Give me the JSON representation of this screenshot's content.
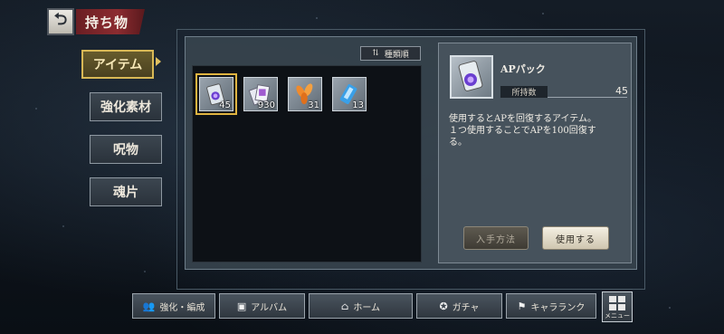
{
  "header": {
    "title": "持ち物"
  },
  "sidebar": {
    "items": [
      {
        "label": "アイテム",
        "active": true
      },
      {
        "label": "強化素材",
        "active": false
      },
      {
        "label": "呪物",
        "active": false
      },
      {
        "label": "魂片",
        "active": false
      }
    ]
  },
  "sort": {
    "label": "種類順"
  },
  "items": [
    {
      "name": "APパック",
      "count": "45",
      "selected": true,
      "icon": "ap-pack-icon"
    },
    {
      "name": "カード",
      "count": "930",
      "selected": false,
      "icon": "cards-icon"
    },
    {
      "name": "葉",
      "count": "31",
      "selected": false,
      "icon": "leaves-icon"
    },
    {
      "name": "クリスタル",
      "count": "13",
      "selected": false,
      "icon": "crystal-icon"
    }
  ],
  "detail": {
    "name": "APパック",
    "owned_label": "所持数",
    "owned_value": "45",
    "description_lines": [
      "使用するとAPを回復するアイテム。",
      "１つ使用することでAPを100回復す",
      "る。"
    ],
    "acquire_label": "入手方法",
    "use_label": "使用する"
  },
  "nav": [
    {
      "label": "強化・編成",
      "icon": "team-icon"
    },
    {
      "label": "アルバム",
      "icon": "album-icon"
    },
    {
      "label": "ホーム",
      "icon": "home-icon"
    },
    {
      "label": "ガチャ",
      "icon": "gacha-icon"
    },
    {
      "label": "キャラランク",
      "icon": "rank-icon"
    }
  ],
  "menu": {
    "label": "メニュー"
  },
  "colors": {
    "accent_gold": "#d8b856",
    "title_red": "#8c2c30",
    "panel": "#46525c"
  }
}
